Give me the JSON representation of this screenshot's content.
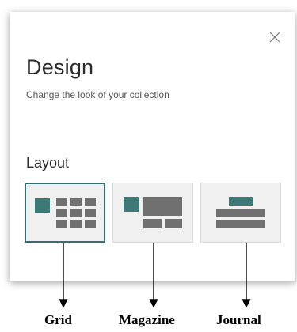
{
  "dialog": {
    "title": "Design",
    "subtitle": "Change the look of your collection",
    "close_icon": "close-icon",
    "layout_section": {
      "label": "Layout",
      "selected": "Grid",
      "options": [
        {
          "name": "Grid",
          "icon": "grid-layout-icon",
          "selected": true
        },
        {
          "name": "Magazine",
          "icon": "magazine-layout-icon",
          "selected": false
        },
        {
          "name": "Journal",
          "icon": "journal-layout-icon",
          "selected": false
        }
      ]
    }
  },
  "annotations": {
    "grid": "Grid",
    "magazine": "Magazine",
    "journal": "Journal"
  },
  "colors": {
    "accent": "#356f73",
    "tile_dark": "#3d7a77",
    "tile_gray": "#707070",
    "option_bg": "#f0f0f0"
  }
}
